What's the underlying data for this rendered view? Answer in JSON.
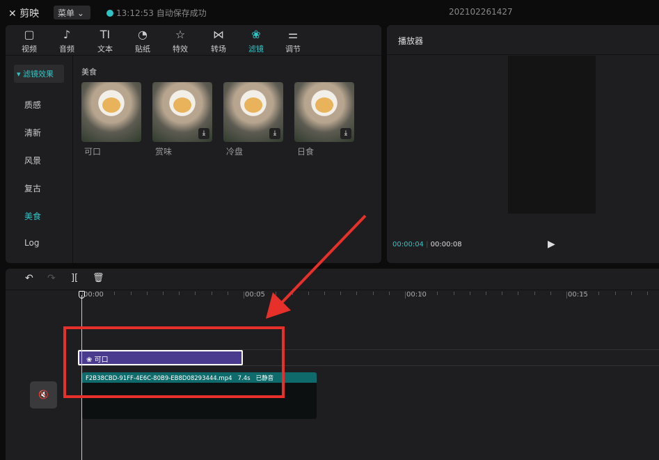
{
  "app": {
    "logo": "剪映",
    "menu": "菜单",
    "save_time": "13:12:53",
    "save_status": "自动保存成功",
    "project": "202102261427"
  },
  "tabs": [
    {
      "label": "视频",
      "icon": "▢"
    },
    {
      "label": "音频",
      "icon": "♪"
    },
    {
      "label": "文本",
      "icon": "TI"
    },
    {
      "label": "贴纸",
      "icon": "◔"
    },
    {
      "label": "特效",
      "icon": "☆"
    },
    {
      "label": "转场",
      "icon": "⋈"
    },
    {
      "label": "滤镜",
      "icon": "❀"
    },
    {
      "label": "调节",
      "icon": "⚌"
    }
  ],
  "sidebar": {
    "header": "滤镜效果",
    "items": [
      "质感",
      "清新",
      "风景",
      "复古",
      "美食",
      "Log"
    ]
  },
  "section_title": "美食",
  "filters": [
    {
      "name": "可口"
    },
    {
      "name": "赏味"
    },
    {
      "name": "冷盘"
    },
    {
      "name": "日食"
    }
  ],
  "player": {
    "title": "播放器",
    "current": "00:00:04",
    "total": "00:00:08"
  },
  "ruler": [
    "00:00",
    "00:05",
    "00:10",
    "00:15"
  ],
  "timeline": {
    "filter_clip": "可口",
    "video_name": "F2B38CBD-91FF-4E6C-80B9-EB8D08293444.mp4",
    "video_duration": "7.4s",
    "muted": "已静音"
  },
  "colors": {
    "accent": "#2fc4c4",
    "filter_clip": "#4b3b8f",
    "video_header": "#0f6b6b",
    "annotation": "#e8302a"
  }
}
